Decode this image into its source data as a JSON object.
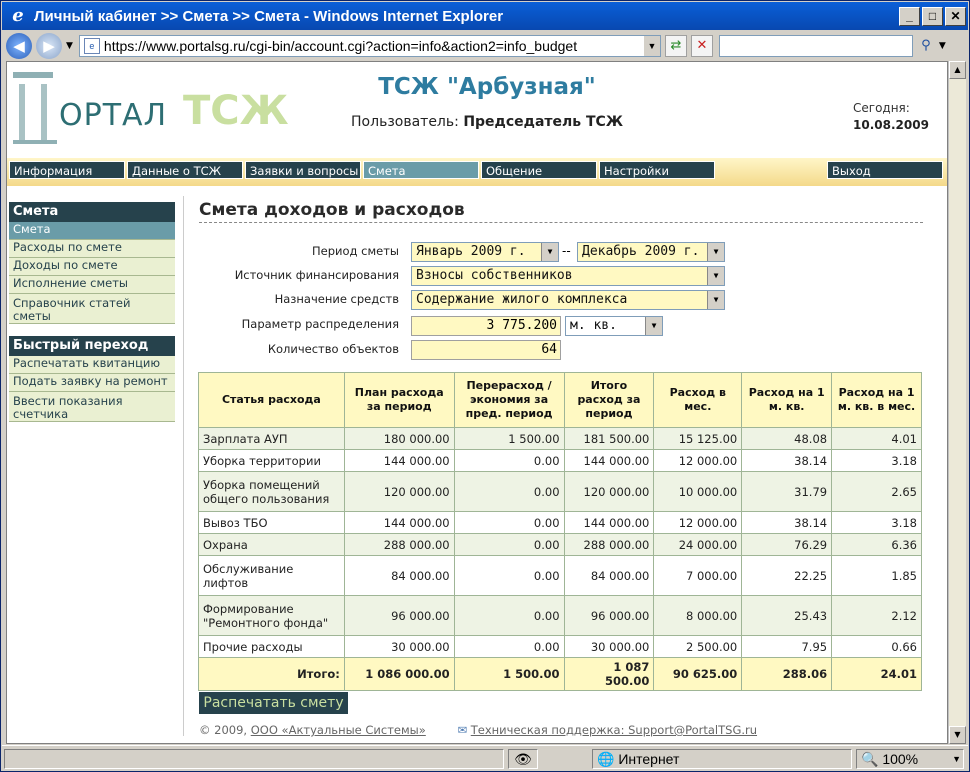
{
  "window": {
    "title": "Личный кабинет >> Смета >> Смета - Windows Internet Explorer"
  },
  "browser": {
    "url": "https://www.portalsg.ru/cgi-bin/account.cgi?action=info&action2=info_budget",
    "search_placeholder": ""
  },
  "header": {
    "logo_part1": "ОРТАЛ",
    "logo_part2": "ТСЖ",
    "org_name": "ТСЖ \"Арбузная\"",
    "user_label": "Пользователь:",
    "user_name": "Председатель ТСЖ",
    "today_label": "Сегодня:",
    "today_date": "10.08.2009"
  },
  "menu": [
    {
      "label": "Информация"
    },
    {
      "label": "Данные о ТСЖ"
    },
    {
      "label": "Заявки и вопросы"
    },
    {
      "label": "Смета"
    },
    {
      "label": "Общение"
    },
    {
      "label": "Настройки"
    },
    {
      "label": "Выход"
    }
  ],
  "sidebar": {
    "group1": "Смета",
    "items1": [
      "Смета",
      "Расходы по смете",
      "Доходы по смете",
      "Исполнение сметы",
      "Справочник статей сметы"
    ],
    "group2": "Быстрый переход",
    "items2": [
      "Распечатать квитанцию",
      "Подать заявку на ремонт",
      "Ввести показания счетчика"
    ]
  },
  "main": {
    "title": "Смета доходов и расходов",
    "form": {
      "period_label": "Период сметы",
      "period_from": "Январь 2009 г.",
      "period_sep": "--",
      "period_to": "Декабрь 2009 г.",
      "source_label": "Источник финансирования",
      "source_value": "Взносы собственников",
      "purpose_label": "Назначение средств",
      "purpose_value": "Содержание жилого комплекса",
      "param_label": "Параметр распределения",
      "param_value": "3 775.200",
      "param_unit": "м. кв.",
      "count_label": "Количество объектов",
      "count_value": "64"
    },
    "table": {
      "headers": [
        "Статья расхода",
        "План расхода за период",
        "Перерасход / экономия за пред. период",
        "Итого расход за период",
        "Расход в мес.",
        "Расход на 1 м. кв.",
        "Расход на 1 м. кв. в мес."
      ],
      "rows": [
        [
          "Зарплата АУП",
          "180 000.00",
          "1 500.00",
          "181 500.00",
          "15 125.00",
          "48.08",
          "4.01"
        ],
        [
          "Уборка территории",
          "144 000.00",
          "0.00",
          "144 000.00",
          "12 000.00",
          "38.14",
          "3.18"
        ],
        [
          "Уборка помещений общего пользования",
          "120 000.00",
          "0.00",
          "120 000.00",
          "10 000.00",
          "31.79",
          "2.65"
        ],
        [
          "Вывоз ТБО",
          "144 000.00",
          "0.00",
          "144 000.00",
          "12 000.00",
          "38.14",
          "3.18"
        ],
        [
          "Охрана",
          "288 000.00",
          "0.00",
          "288 000.00",
          "24 000.00",
          "76.29",
          "6.36"
        ],
        [
          "Обслуживание лифтов",
          "84 000.00",
          "0.00",
          "84 000.00",
          "7 000.00",
          "22.25",
          "1.85"
        ],
        [
          "Формирование \"Ремонтного фонда\"",
          "96 000.00",
          "0.00",
          "96 000.00",
          "8 000.00",
          "25.43",
          "2.12"
        ],
        [
          "Прочие расходы",
          "30 000.00",
          "0.00",
          "30 000.00",
          "2 500.00",
          "7.95",
          "0.66"
        ]
      ],
      "total": [
        "Итого:",
        "1 086 000.00",
        "1 500.00",
        "1 087 500.00",
        "90 625.00",
        "288.06",
        "24.01"
      ]
    },
    "print_button": "Распечатать смету"
  },
  "footer": {
    "copyright": "© 2009,",
    "company": "ООО «Актуальные Системы»",
    "support": "Техническая поддержка: Support@PortalTSG.ru"
  },
  "status": {
    "zone": "Интернет",
    "zoom": "100%"
  }
}
